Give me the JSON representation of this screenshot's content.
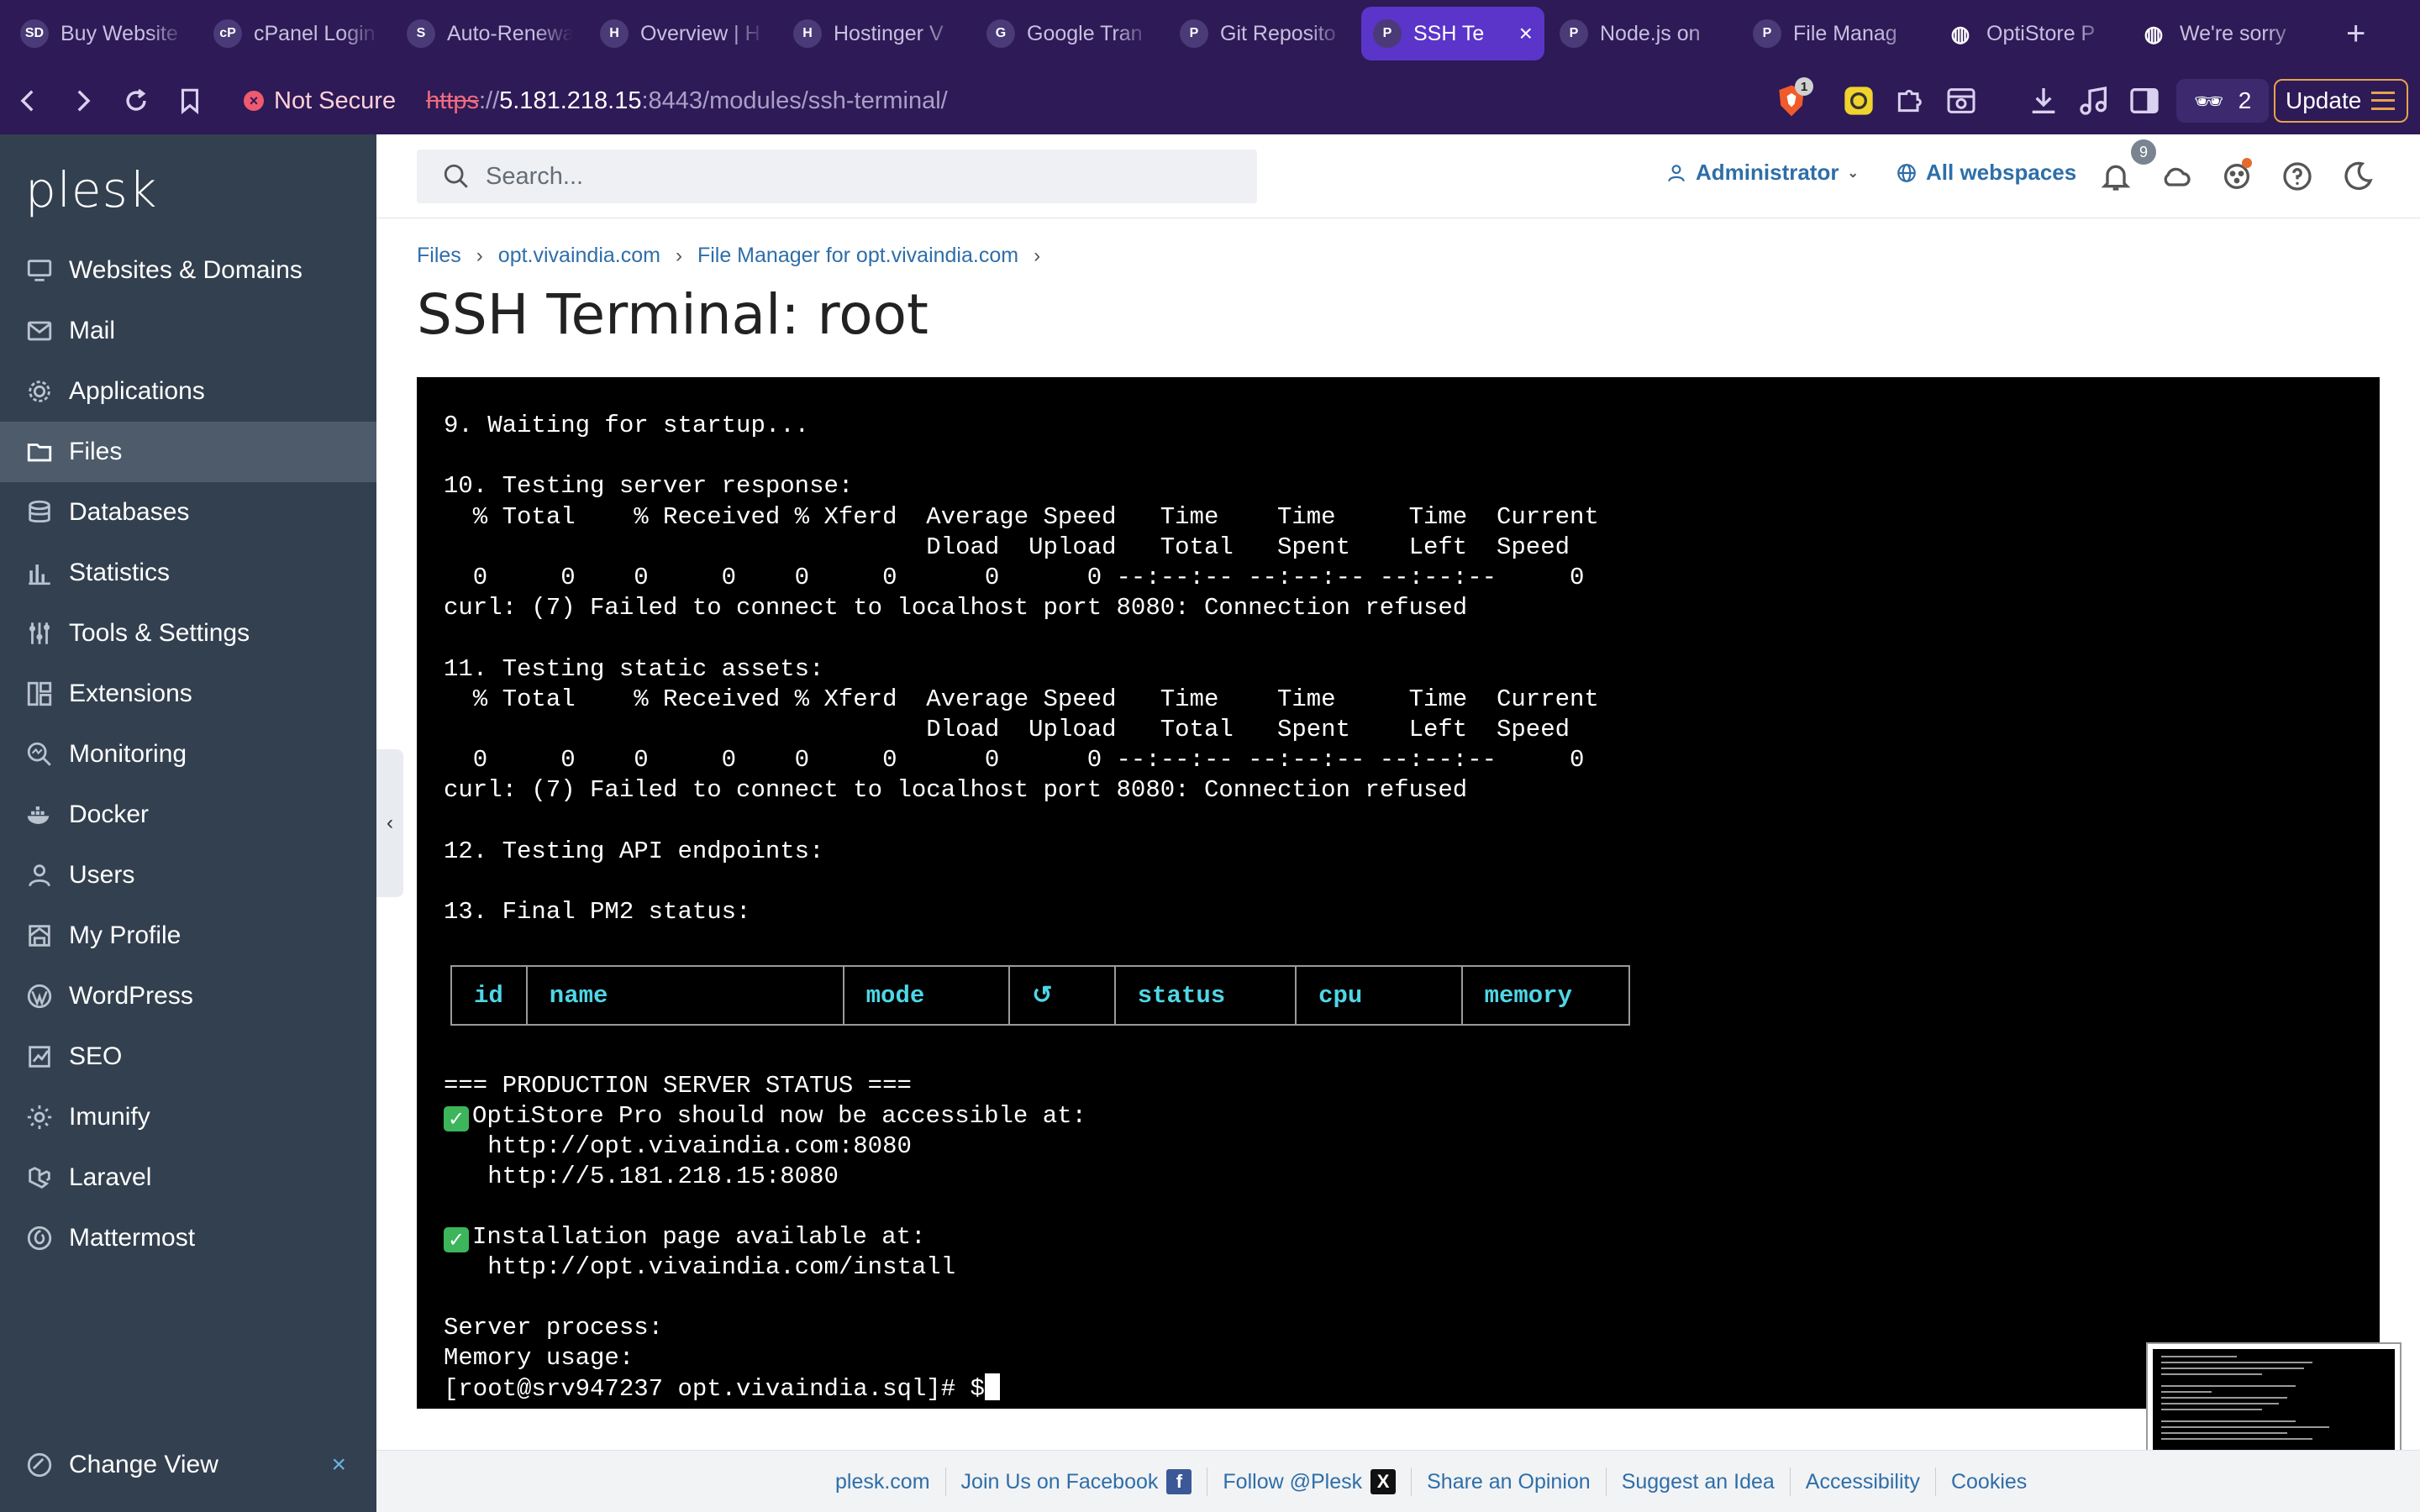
{
  "browser": {
    "tabs": [
      {
        "title": "Buy Website",
        "favicon": "SD"
      },
      {
        "title": "cPanel Login",
        "favicon": "cP"
      },
      {
        "title": "Auto-Renewal",
        "favicon": "S"
      },
      {
        "title": "Overview | H",
        "favicon": "H"
      },
      {
        "title": "Hostinger V",
        "favicon": "H"
      },
      {
        "title": "Google Tran",
        "favicon": "G"
      },
      {
        "title": "Git Reposito",
        "favicon": "P"
      },
      {
        "title": "SSH Te",
        "favicon": "P",
        "active": true
      },
      {
        "title": "Node.js on",
        "favicon": "P"
      },
      {
        "title": "File Manag",
        "favicon": "P"
      },
      {
        "title": "OptiStore P",
        "favicon": "globe"
      },
      {
        "title": "We're sorry",
        "favicon": "globe"
      }
    ],
    "new_tab": "+",
    "not_secure_label": "Not Secure",
    "url_protocol": "https",
    "url_sep": "://",
    "url_host": "5.181.218.15",
    "url_rest": ":8443/modules/ssh-terminal/",
    "shield_count": "1",
    "vpn_count": "2",
    "update_label": "Update",
    "accent": "#5b34c9",
    "chrome_bg": "#2d1a56"
  },
  "sidebar": {
    "logo": "plesk",
    "items": [
      {
        "label": "Websites & Domains",
        "icon": "monitor-icon"
      },
      {
        "label": "Mail",
        "icon": "mail-icon"
      },
      {
        "label": "Applications",
        "icon": "gear-icon"
      },
      {
        "label": "Files",
        "icon": "folder-icon",
        "active": true
      },
      {
        "label": "Databases",
        "icon": "database-icon"
      },
      {
        "label": "Statistics",
        "icon": "bar-chart-icon"
      },
      {
        "label": "Tools & Settings",
        "icon": "sliders-icon"
      },
      {
        "label": "Extensions",
        "icon": "grid-icon"
      },
      {
        "label": "Monitoring",
        "icon": "magnifier-icon"
      },
      {
        "label": "Docker",
        "icon": "docker-icon"
      },
      {
        "label": "Users",
        "icon": "user-icon"
      },
      {
        "label": "My Profile",
        "icon": "profile-icon"
      },
      {
        "label": "WordPress",
        "icon": "wordpress-icon"
      },
      {
        "label": "SEO",
        "icon": "seo-icon"
      },
      {
        "label": "Imunify",
        "icon": "cog-icon"
      },
      {
        "label": "Laravel",
        "icon": "laravel-icon"
      },
      {
        "label": "Mattermost",
        "icon": "mattermost-icon"
      }
    ],
    "change_view": "Change View",
    "bg": "#33404f"
  },
  "header": {
    "search_placeholder": "Search...",
    "admin_label": "Administrator",
    "webspaces_label": "All webspaces",
    "notification_count": "9"
  },
  "breadcrumb": [
    "Files",
    "opt.vivaindia.com",
    "File Manager for opt.vivaindia.com"
  ],
  "page_title": "SSH Terminal: root",
  "terminal": {
    "lines": [
      "9. Waiting for startup...",
      "",
      "10. Testing server response:",
      "  % Total    % Received % Xferd  Average Speed   Time    Time     Time  Current",
      "                                 Dload  Upload   Total   Spent    Left  Speed",
      "  0     0    0     0    0     0      0      0 --:--:-- --:--:-- --:--:--     0",
      "curl: (7) Failed to connect to localhost port 8080: Connection refused",
      "",
      "11. Testing static assets:",
      "  % Total    % Received % Xferd  Average Speed   Time    Time     Time  Current",
      "                                 Dload  Upload   Total   Spent    Left  Speed",
      "  0     0    0     0    0     0      0      0 --:--:-- --:--:-- --:--:--     0",
      "curl: (7) Failed to connect to localhost port 8080: Connection refused",
      "",
      "12. Testing API endpoints:",
      "",
      "13. Final PM2 status:"
    ],
    "pm2_headers": [
      "id",
      "name",
      "mode",
      "↺",
      "status",
      "cpu",
      "memory"
    ],
    "status_heading": "=== PRODUCTION SERVER STATUS ===",
    "accessible_msg": "OptiStore Pro should now be accessible at:",
    "url1": "   http://opt.vivaindia.com:8080",
    "url2": "   http://5.181.218.15:8080",
    "install_msg": "Installation page available at:",
    "install_url": "   http://opt.vivaindia.com/install",
    "server_process": "Server process:",
    "memory_usage": "Memory usage:",
    "prompt": "[root@srv947237 opt.vivaindia.sql]# $"
  },
  "footer": {
    "links": [
      "plesk.com",
      "Join Us on Facebook",
      "Follow @Plesk",
      "Share an Opinion",
      "Suggest an Idea",
      "Accessibility",
      "Cookies"
    ]
  }
}
